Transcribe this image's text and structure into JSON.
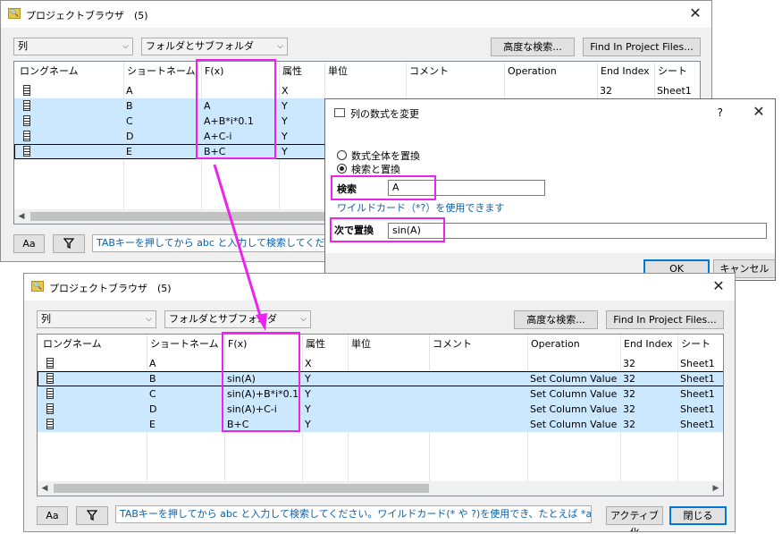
{
  "top": {
    "title": "プロジェクトブラウザ　(5)",
    "combo_type": "列",
    "combo_folder": "フォルダとサブフォルダ",
    "adv_search": "高度な検索...",
    "find_files": "Find In Project Files...",
    "headers": [
      "ロングネーム",
      "ショートネーム",
      "F(x)",
      "属性",
      "単位",
      "コメント",
      "Operation",
      "End Index",
      "シート"
    ],
    "rows": [
      {
        "short": "A",
        "fx": "",
        "attr": "X",
        "op": "",
        "end": "32",
        "sheet": "Sheet1"
      },
      {
        "short": "B",
        "fx": "A",
        "attr": "Y",
        "op": "",
        "end": "",
        "sheet": ""
      },
      {
        "short": "C",
        "fx": "A+B*i*0.1",
        "attr": "Y",
        "op": "",
        "end": "",
        "sheet": ""
      },
      {
        "short": "D",
        "fx": "A+C-i",
        "attr": "Y",
        "op": "",
        "end": "",
        "sheet": ""
      },
      {
        "short": "E",
        "fx": "B+C",
        "attr": "Y",
        "op": "",
        "end": "",
        "sheet": ""
      }
    ],
    "aa": "Aa",
    "search_hint": "TABキーを押してから abc と入力して検索してくださ"
  },
  "dialog": {
    "title": "列の数式を変更",
    "help": "?",
    "opt_all": "数式全体を置換",
    "opt_search": "検索と置換",
    "search_label": "検索",
    "search_value": "A",
    "wildcard": "ワイルドカード（*?）を使用できます",
    "replace_label": "次で置換",
    "replace_value": "sin(A)",
    "ok": "OK",
    "cancel": "キャンセル"
  },
  "bottom": {
    "title": "プロジェクトブラウザ　(5)",
    "combo_type": "列",
    "combo_folder": "フォルダとサブフォルダ",
    "adv_search": "高度な検索...",
    "find_files": "Find In Project Files...",
    "headers": [
      "ロングネーム",
      "ショートネーム",
      "F(x)",
      "属性",
      "単位",
      "コメント",
      "Operation",
      "End Index",
      "シート"
    ],
    "rows": [
      {
        "short": "A",
        "fx": "",
        "attr": "X",
        "op": "",
        "end": "32",
        "sheet": "Sheet1"
      },
      {
        "short": "B",
        "fx": "sin(A)",
        "attr": "Y",
        "op": "Set Column Value",
        "end": "32",
        "sheet": "Sheet1"
      },
      {
        "short": "C",
        "fx": "sin(A)+B*i*0.1",
        "attr": "Y",
        "op": "Set Column Value",
        "end": "32",
        "sheet": "Sheet1"
      },
      {
        "short": "D",
        "fx": "sin(A)+C-i",
        "attr": "Y",
        "op": "Set Column Value",
        "end": "32",
        "sheet": "Sheet1"
      },
      {
        "short": "E",
        "fx": "B+C",
        "attr": "Y",
        "op": "Set Column Value",
        "end": "32",
        "sheet": "Sheet1"
      }
    ],
    "aa": "Aa",
    "search_hint": "TABキーを押してから abc と入力して検索してください。ワイルドカード(* や ?)を使用でき、たとえば *abc",
    "activate": "アクティブ化",
    "close": "閉じる"
  },
  "colors": {
    "selection": "#cce8ff",
    "highlight": "#ee22ee",
    "accent": "#0078d7"
  }
}
